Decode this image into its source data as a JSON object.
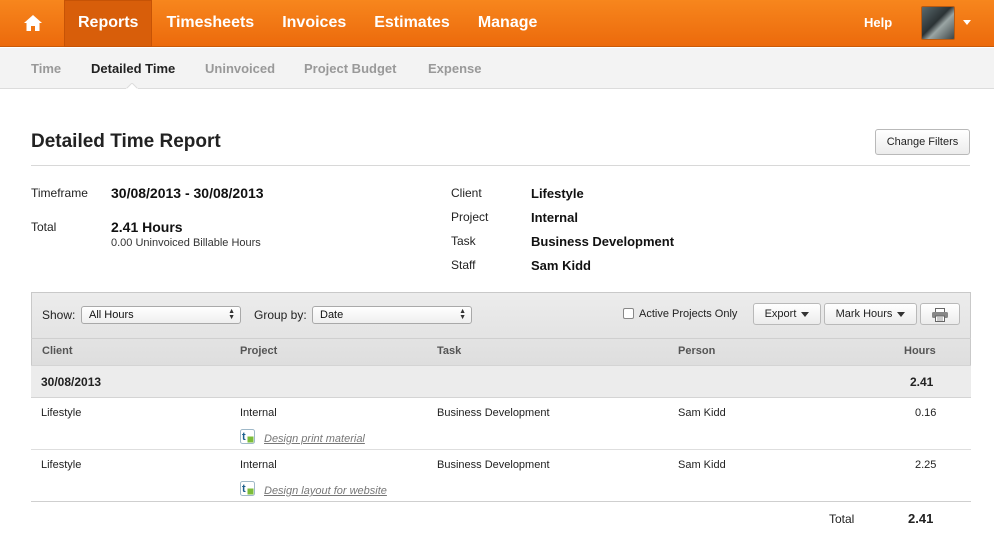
{
  "nav": {
    "items": [
      "Reports",
      "Timesheets",
      "Invoices",
      "Estimates",
      "Manage"
    ],
    "help": "Help"
  },
  "subnav": {
    "items": [
      "Time",
      "Detailed Time",
      "Uninvoiced",
      "Project Budget",
      "Expense"
    ],
    "active": "Detailed Time"
  },
  "page": {
    "title": "Detailed Time Report",
    "change_filters": "Change Filters"
  },
  "summary": {
    "timeframe_label": "Timeframe",
    "timeframe": "30/08/2013 - 30/08/2013",
    "total_label": "Total",
    "total": "2.41 Hours",
    "uninvoiced": "0.00 Uninvoiced Billable Hours",
    "client_label": "Client",
    "client": "Lifestyle",
    "project_label": "Project",
    "project": "Internal",
    "task_label": "Task",
    "task": "Business Development",
    "staff_label": "Staff",
    "staff": "Sam Kidd"
  },
  "toolbar": {
    "show_label": "Show:",
    "show_value": "All Hours",
    "group_label": "Group by:",
    "group_value": "Date",
    "active_only": "Active Projects Only",
    "export": "Export",
    "mark_hours": "Mark Hours"
  },
  "table": {
    "columns": [
      "Client",
      "Project",
      "Task",
      "Person",
      "Hours"
    ],
    "group": {
      "date": "30/08/2013",
      "hours": "2.41"
    },
    "rows": [
      {
        "client": "Lifestyle",
        "project": "Internal",
        "task": "Business Development",
        "person": "Sam Kidd",
        "hours": "0.16",
        "note": "Design print material"
      },
      {
        "client": "Lifestyle",
        "project": "Internal",
        "task": "Business Development",
        "person": "Sam Kidd",
        "hours": "2.25",
        "note": "Design layout for website"
      }
    ],
    "total_label": "Total",
    "total": "2.41"
  },
  "colors": {
    "accent": "#ef7611",
    "active_tab": "#d85e0a"
  }
}
